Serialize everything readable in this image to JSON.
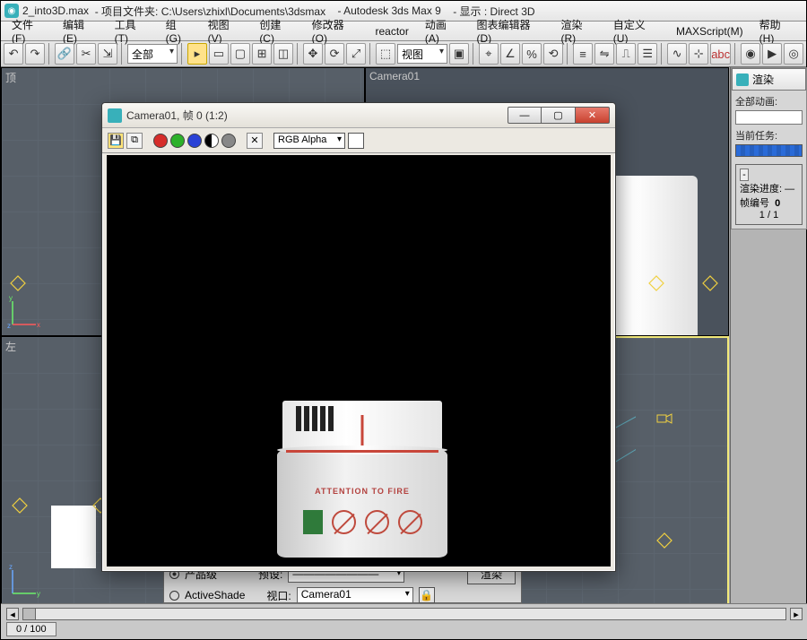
{
  "title": {
    "file": "2_into3D.max",
    "folder_label": "- 项目文件夹: C:\\Users\\zhixl\\Documents\\3dsmax",
    "app": "- Autodesk 3ds Max 9",
    "display": "- 显示 : Direct 3D"
  },
  "menu": [
    "文件(F)",
    "编辑(E)",
    "工具(T)",
    "组(G)",
    "视图(V)",
    "创建(C)",
    "修改器(O)",
    "reactor",
    "动画(A)",
    "图表编辑器(D)",
    "渲染(R)",
    "自定义(U)",
    "MAXScript(M)",
    "帮助(H)"
  ],
  "toolbar": {
    "scope": "全部",
    "viewmode": "视图"
  },
  "viewports": {
    "tl": "顶",
    "tr": "Camera01",
    "bl": "左",
    "br": ""
  },
  "timeline": {
    "frame": "0 / 100"
  },
  "renderScene": {
    "row1_opt_label": "产品级",
    "row1_combo_label": "预设:",
    "row2_opt": "ActiveShade",
    "row2_label": "视口:",
    "row2_value": "Camera01",
    "render_btn": "渲染"
  },
  "renderFloat": {
    "title": "Camera01, 帧 0 (1:2)",
    "channel": "RGB Alpha",
    "attention": "ATTENTION TO FIRE"
  },
  "renderPanel": {
    "title": "渲染",
    "anim_label": "全部动画:",
    "task_label": "当前任务:",
    "progress_label": "渲染进度:",
    "frame_label": "帧编号",
    "frame_value": "0",
    "frame_total": "1 / 1"
  }
}
